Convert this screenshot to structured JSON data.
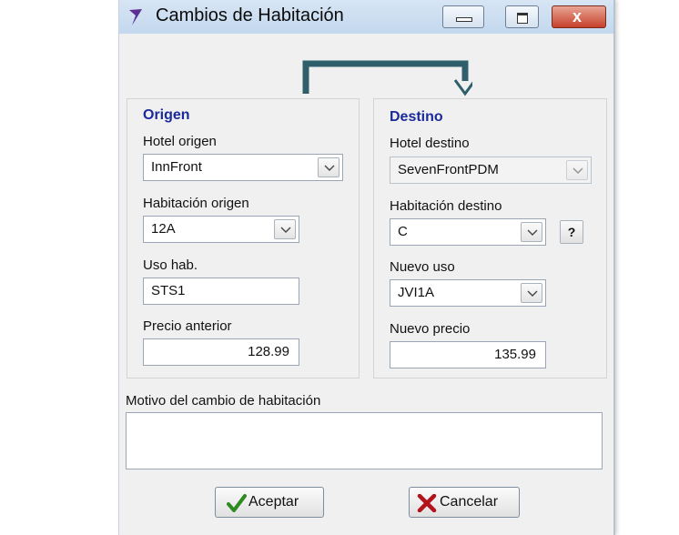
{
  "window": {
    "title": "Cambios de Habitación",
    "controls": {
      "minimize": "minimize",
      "maximize": "maximize",
      "close": "x"
    }
  },
  "origin": {
    "title": "Origen",
    "hotel_label": "Hotel origen",
    "hotel_value": "InnFront",
    "room_label": "Habitación origen",
    "room_value": "12A",
    "usage_label": "Uso hab.",
    "usage_value": "STS1",
    "price_label": "Precio anterior",
    "price_value": "128.99"
  },
  "destination": {
    "title": "Destino",
    "hotel_label": "Hotel destino",
    "hotel_value": "SevenFrontPDM",
    "room_label": "Habitación destino",
    "room_value": "C",
    "help_button": "?",
    "usage_label": "Nuevo uso",
    "usage_value": "JVI1A",
    "price_label": "Nuevo precio",
    "price_value": "135.99"
  },
  "reason": {
    "label": "Motivo del cambio de habitación",
    "value": ""
  },
  "buttons": {
    "accept": "Aceptar",
    "cancel": "Cancelar"
  },
  "colors": {
    "group_title": "#1b2a9a",
    "arrow": "#2f5f6b",
    "accept_check": "#2e8b1f",
    "cancel_x": "#b3141b"
  }
}
